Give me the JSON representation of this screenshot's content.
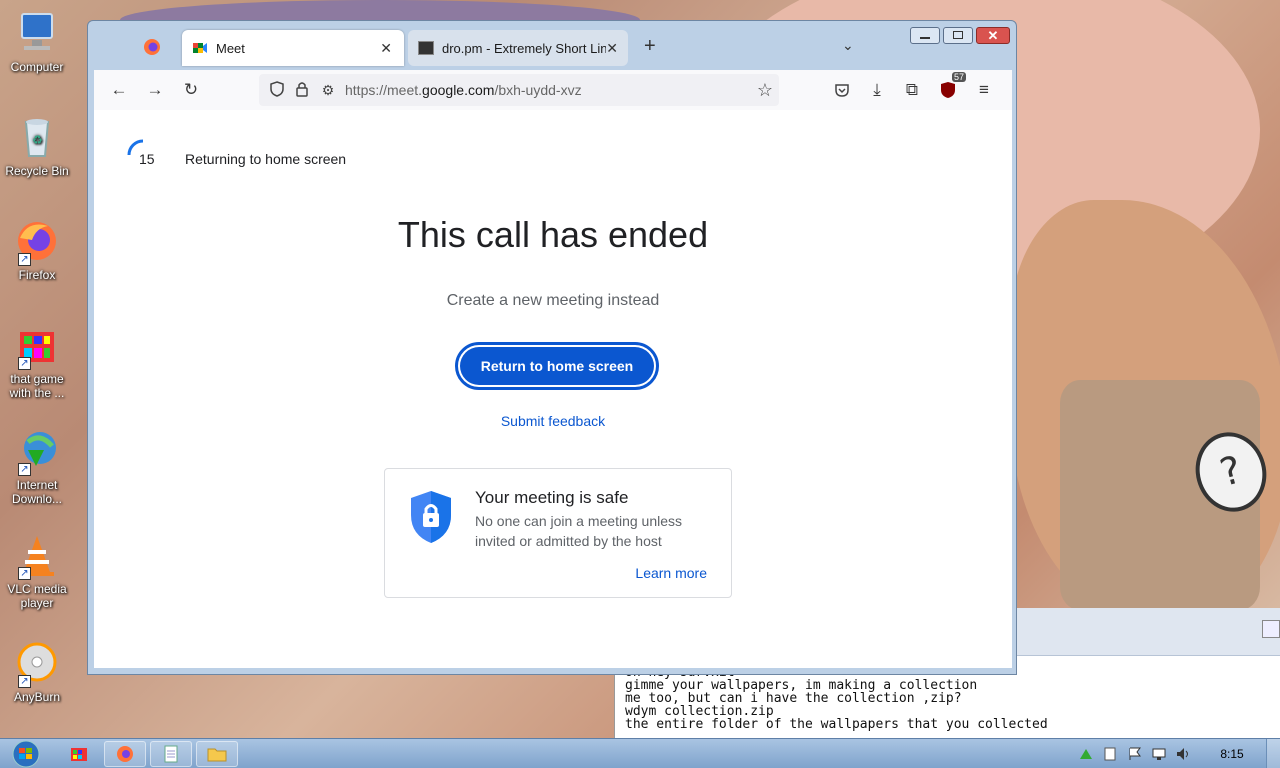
{
  "desktop": {
    "icons": [
      {
        "name": "desktop-icon-computer",
        "label": "Computer"
      },
      {
        "name": "desktop-icon-recycle-bin",
        "label": "Recycle Bin"
      },
      {
        "name": "desktop-icon-firefox",
        "label": "Firefox"
      },
      {
        "name": "desktop-icon-game",
        "label": "that game with the ..."
      },
      {
        "name": "desktop-icon-internet-download",
        "label": "Internet Downlo..."
      },
      {
        "name": "desktop-icon-vlc",
        "label": "VLC media player"
      },
      {
        "name": "desktop-icon-anyburn",
        "label": "AnyBurn"
      }
    ],
    "chat_lines": "oh hey survxit\ngimme your wallpapers, im making a collection\nme too, but can i have the collection ,zip?\nwdym collection.zip\nthe entire folder of the wallpapers that you collected"
  },
  "browser": {
    "tabs": [
      {
        "label": "Meet",
        "active": true
      },
      {
        "label": "dro.pm - Extremely Short Links",
        "active": false
      }
    ],
    "url": {
      "prefix": "https://meet.",
      "domain": "google.com",
      "path": "/bxh-uydd-xvz"
    },
    "extension_badge": "57"
  },
  "meet": {
    "countdown": "15",
    "returning_text": "Returning to home screen",
    "title": "This call has ended",
    "subtitle": "Create a new meeting instead",
    "return_button": "Return to home screen",
    "feedback_link": "Submit feedback",
    "safe_title": "Your meeting is safe",
    "safe_description": "No one can join a meeting unless invited or admitted by the host",
    "learn_more": "Learn more"
  },
  "taskbar": {
    "clock": "8:15"
  },
  "colors": {
    "accent": "#0b57d0",
    "shield": "#4285f4"
  }
}
